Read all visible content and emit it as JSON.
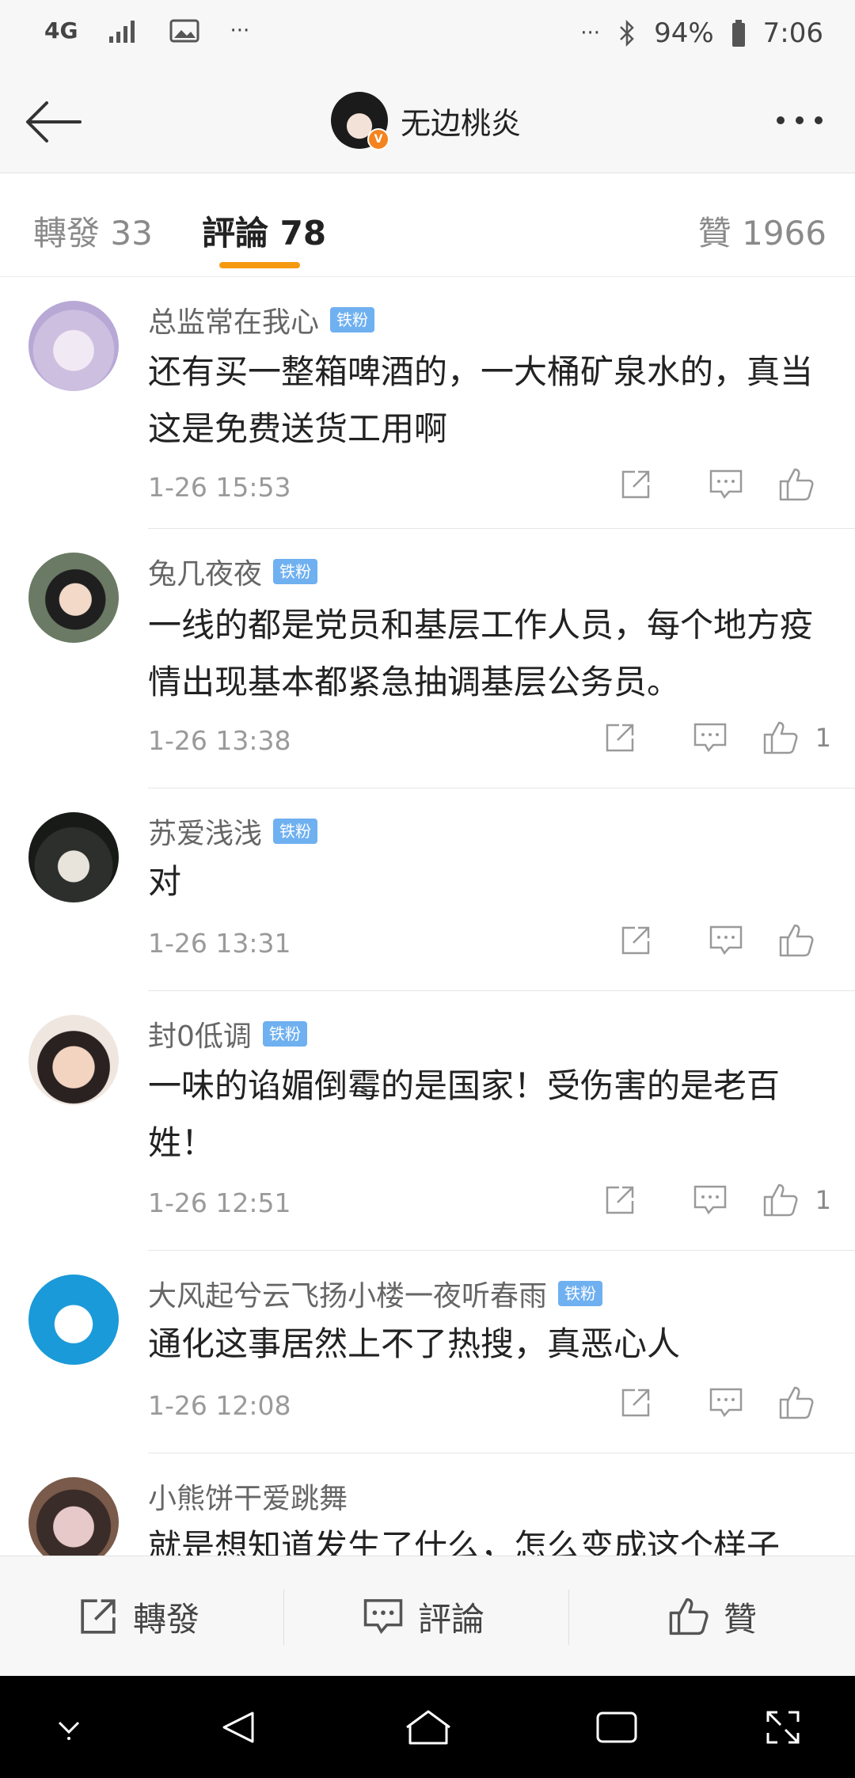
{
  "status_bar": {
    "network": "4G",
    "more": "···",
    "more_right": "···",
    "battery": "94%",
    "time": "7:06"
  },
  "header": {
    "username": "无边桃炎",
    "verified_mark": "V"
  },
  "tabs": {
    "repost": "轉發 33",
    "comment": "評論 78",
    "like": "贊 1966"
  },
  "badge_label": "铁粉",
  "comments": [
    {
      "name": "总监常在我心",
      "badge": true,
      "text": "还有买一整箱啤酒的，一大桶矿泉水的，真当这是免费送货工用啊",
      "time": "1-26 15:53",
      "likes": ""
    },
    {
      "name": "兔几夜夜",
      "badge": true,
      "text": "一线的都是党员和基层工作人员，每个地方疫情出现基本都紧急抽调基层公务员。",
      "time": "1-26 13:38",
      "likes": "1"
    },
    {
      "name": "苏爱浅浅",
      "badge": true,
      "text": "对",
      "time": "1-26 13:31",
      "likes": ""
    },
    {
      "name": "封0低调",
      "badge": true,
      "text": "一味的谄媚倒霉的是国家！受伤害的是老百姓！",
      "time": "1-26 12:51",
      "likes": "1"
    },
    {
      "name": "大风起兮云飞扬小楼一夜听春雨",
      "badge": true,
      "text": "通化这事居然上不了热搜，真恶心人",
      "time": "1-26 12:08",
      "likes": ""
    },
    {
      "name": "小熊饼干爱跳舞",
      "badge": false,
      "text": "就是想知道发生了什么，怎么变成这个样子",
      "time": "",
      "likes": ""
    }
  ],
  "bottom_bar": {
    "repost": "轉發",
    "comment": "評論",
    "like": "贊"
  },
  "colors": {
    "accent": "#f59a10",
    "badge": "#6fb0f0",
    "verified": "#f5841f"
  }
}
